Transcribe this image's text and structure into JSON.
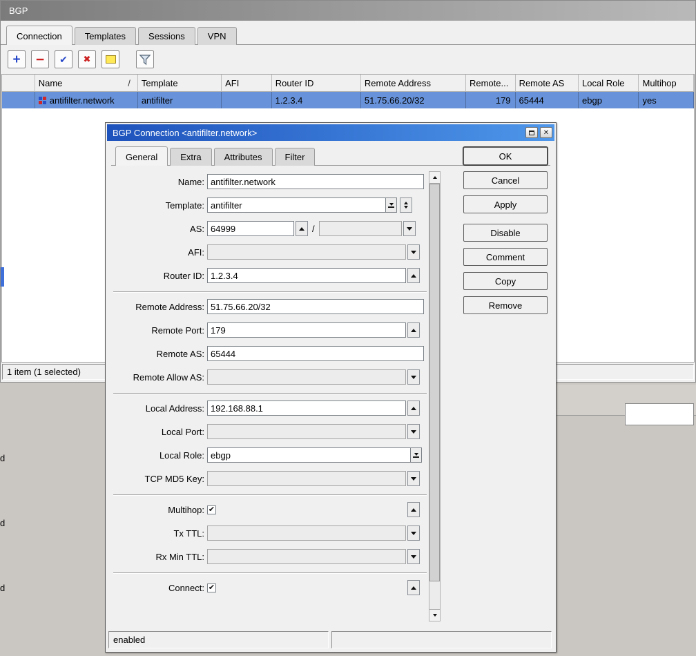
{
  "colors": {
    "selection_blue": "#6893da",
    "titlebar_active_left": "#1e52bc",
    "titlebar_active_right": "#4e97ea",
    "titlebar_inactive_left": "#7b7b7b",
    "titlebar_inactive_right": "#b9b9b9",
    "accent_blue": "#2546c8",
    "accent_red": "#cc2020",
    "comment_yellow": "#ffe957"
  },
  "icons": {
    "add": "+",
    "remove": "−",
    "enable": "✔",
    "disable": "✖",
    "close": "✕",
    "check": "✔",
    "sort_ascending": "/"
  },
  "window": {
    "title": "BGP",
    "tabs": [
      "Connection",
      "Templates",
      "Sessions",
      "VPN"
    ],
    "table": {
      "columns": [
        "Name",
        "Template",
        "AFI",
        "Router ID",
        "Remote Address",
        "Remote...",
        "Remote AS",
        "Local Role",
        "Multihop"
      ],
      "row": {
        "name": "antifilter.network",
        "template": "antifilter",
        "afi": "",
        "router_id": "1.2.3.4",
        "remote_address": "51.75.66.20/32",
        "remote_port": "179",
        "remote_as": "65444",
        "local_role": "ebgp",
        "multihop": "yes"
      }
    },
    "status": "1 item (1 selected)"
  },
  "dialog": {
    "title": "BGP Connection <antifilter.network>",
    "tabs": [
      "General",
      "Extra",
      "Attributes",
      "Filter"
    ],
    "fields": {
      "name": {
        "label": "Name:",
        "value": "antifilter.network"
      },
      "template": {
        "label": "Template:",
        "value": "antifilter"
      },
      "as": {
        "label": "AS:",
        "value": "64999",
        "secondary_value": "",
        "separator": "/"
      },
      "afi": {
        "label": "AFI:",
        "value": ""
      },
      "router_id": {
        "label": "Router ID:",
        "value": "1.2.3.4"
      },
      "remote_address": {
        "label": "Remote Address:",
        "value": "51.75.66.20/32"
      },
      "remote_port": {
        "label": "Remote Port:",
        "value": "179"
      },
      "remote_as": {
        "label": "Remote AS:",
        "value": "65444"
      },
      "remote_allow_as": {
        "label": "Remote Allow AS:",
        "value": ""
      },
      "local_address": {
        "label": "Local Address:",
        "value": "192.168.88.1"
      },
      "local_port": {
        "label": "Local Port:",
        "value": ""
      },
      "local_role": {
        "label": "Local Role:",
        "value": "ebgp"
      },
      "tcp_md5_key": {
        "label": "TCP MD5 Key:",
        "value": ""
      },
      "multihop": {
        "label": "Multihop:",
        "checked": true
      },
      "tx_ttl": {
        "label": "Tx TTL:",
        "value": ""
      },
      "rx_min_ttl": {
        "label": "Rx Min TTL:",
        "value": ""
      },
      "connect": {
        "label": "Connect:",
        "checked": true
      }
    },
    "buttons": [
      "OK",
      "Cancel",
      "Apply",
      "Disable",
      "Comment",
      "Copy",
      "Remove"
    ],
    "status": "enabled"
  },
  "background": {
    "fragments": [
      "d",
      "d",
      "d"
    ]
  }
}
